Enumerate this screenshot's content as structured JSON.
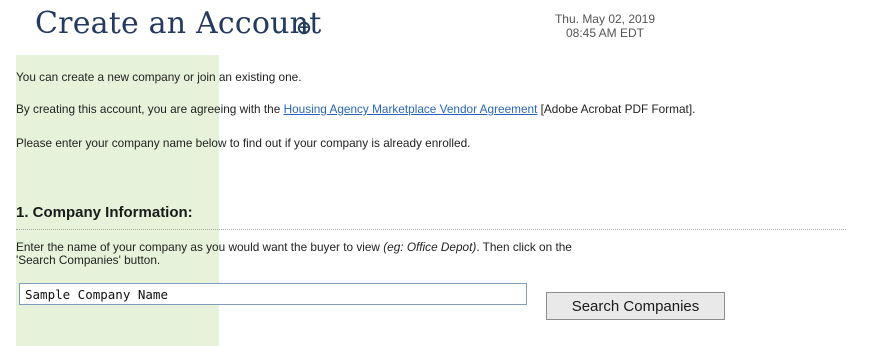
{
  "header": {
    "title": "Create an Account",
    "help_icon": "help-icon",
    "date": "Thu. May 02, 2019",
    "time": "08:45 AM EDT"
  },
  "intro": {
    "line1": "You can create a new company or join an existing one.",
    "line2_before": "By creating this account, you are agreeing with the ",
    "agreement_link": "Housing Agency Marketplace Vendor Agreement",
    "line2_after": " [Adobe Acrobat PDF Format].",
    "line3": "Please enter your company name below to find out if your company is already enrolled."
  },
  "company_section": {
    "heading": "1. Company Information:",
    "instructions_before": "Enter the name of your company as you would want the buyer to view ",
    "instructions_example": "(eg: Office Depot)",
    "instructions_after": ". Then click on the 'Search Companies' button.",
    "company_name_value": "Sample Company Name",
    "search_button_label": "Search Companies"
  },
  "colors": {
    "title": "#243a5e",
    "side_strip": "#e6f2d9",
    "link": "#2a66b8"
  }
}
